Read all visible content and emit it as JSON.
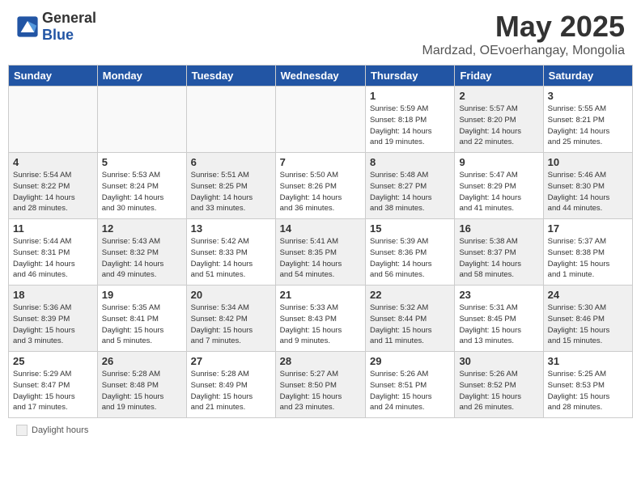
{
  "header": {
    "logo_general": "General",
    "logo_blue": "Blue",
    "month_year": "May 2025",
    "location": "Mardzad, OEvoerhangay, Mongolia"
  },
  "days_of_week": [
    "Sunday",
    "Monday",
    "Tuesday",
    "Wednesday",
    "Thursday",
    "Friday",
    "Saturday"
  ],
  "weeks": [
    [
      {
        "day": "",
        "info": "",
        "empty": true
      },
      {
        "day": "",
        "info": "",
        "empty": true
      },
      {
        "day": "",
        "info": "",
        "empty": true
      },
      {
        "day": "",
        "info": "",
        "empty": true
      },
      {
        "day": "1",
        "info": "Sunrise: 5:59 AM\nSunset: 8:18 PM\nDaylight: 14 hours\nand 19 minutes."
      },
      {
        "day": "2",
        "info": "Sunrise: 5:57 AM\nSunset: 8:20 PM\nDaylight: 14 hours\nand 22 minutes.",
        "shaded": true
      },
      {
        "day": "3",
        "info": "Sunrise: 5:55 AM\nSunset: 8:21 PM\nDaylight: 14 hours\nand 25 minutes."
      }
    ],
    [
      {
        "day": "4",
        "info": "Sunrise: 5:54 AM\nSunset: 8:22 PM\nDaylight: 14 hours\nand 28 minutes.",
        "shaded": true
      },
      {
        "day": "5",
        "info": "Sunrise: 5:53 AM\nSunset: 8:24 PM\nDaylight: 14 hours\nand 30 minutes."
      },
      {
        "day": "6",
        "info": "Sunrise: 5:51 AM\nSunset: 8:25 PM\nDaylight: 14 hours\nand 33 minutes.",
        "shaded": true
      },
      {
        "day": "7",
        "info": "Sunrise: 5:50 AM\nSunset: 8:26 PM\nDaylight: 14 hours\nand 36 minutes."
      },
      {
        "day": "8",
        "info": "Sunrise: 5:48 AM\nSunset: 8:27 PM\nDaylight: 14 hours\nand 38 minutes.",
        "shaded": true
      },
      {
        "day": "9",
        "info": "Sunrise: 5:47 AM\nSunset: 8:29 PM\nDaylight: 14 hours\nand 41 minutes."
      },
      {
        "day": "10",
        "info": "Sunrise: 5:46 AM\nSunset: 8:30 PM\nDaylight: 14 hours\nand 44 minutes.",
        "shaded": true
      }
    ],
    [
      {
        "day": "11",
        "info": "Sunrise: 5:44 AM\nSunset: 8:31 PM\nDaylight: 14 hours\nand 46 minutes."
      },
      {
        "day": "12",
        "info": "Sunrise: 5:43 AM\nSunset: 8:32 PM\nDaylight: 14 hours\nand 49 minutes.",
        "shaded": true
      },
      {
        "day": "13",
        "info": "Sunrise: 5:42 AM\nSunset: 8:33 PM\nDaylight: 14 hours\nand 51 minutes."
      },
      {
        "day": "14",
        "info": "Sunrise: 5:41 AM\nSunset: 8:35 PM\nDaylight: 14 hours\nand 54 minutes.",
        "shaded": true
      },
      {
        "day": "15",
        "info": "Sunrise: 5:39 AM\nSunset: 8:36 PM\nDaylight: 14 hours\nand 56 minutes."
      },
      {
        "day": "16",
        "info": "Sunrise: 5:38 AM\nSunset: 8:37 PM\nDaylight: 14 hours\nand 58 minutes.",
        "shaded": true
      },
      {
        "day": "17",
        "info": "Sunrise: 5:37 AM\nSunset: 8:38 PM\nDaylight: 15 hours\nand 1 minute."
      }
    ],
    [
      {
        "day": "18",
        "info": "Sunrise: 5:36 AM\nSunset: 8:39 PM\nDaylight: 15 hours\nand 3 minutes.",
        "shaded": true
      },
      {
        "day": "19",
        "info": "Sunrise: 5:35 AM\nSunset: 8:41 PM\nDaylight: 15 hours\nand 5 minutes."
      },
      {
        "day": "20",
        "info": "Sunrise: 5:34 AM\nSunset: 8:42 PM\nDaylight: 15 hours\nand 7 minutes.",
        "shaded": true
      },
      {
        "day": "21",
        "info": "Sunrise: 5:33 AM\nSunset: 8:43 PM\nDaylight: 15 hours\nand 9 minutes."
      },
      {
        "day": "22",
        "info": "Sunrise: 5:32 AM\nSunset: 8:44 PM\nDaylight: 15 hours\nand 11 minutes.",
        "shaded": true
      },
      {
        "day": "23",
        "info": "Sunrise: 5:31 AM\nSunset: 8:45 PM\nDaylight: 15 hours\nand 13 minutes."
      },
      {
        "day": "24",
        "info": "Sunrise: 5:30 AM\nSunset: 8:46 PM\nDaylight: 15 hours\nand 15 minutes.",
        "shaded": true
      }
    ],
    [
      {
        "day": "25",
        "info": "Sunrise: 5:29 AM\nSunset: 8:47 PM\nDaylight: 15 hours\nand 17 minutes."
      },
      {
        "day": "26",
        "info": "Sunrise: 5:28 AM\nSunset: 8:48 PM\nDaylight: 15 hours\nand 19 minutes.",
        "shaded": true
      },
      {
        "day": "27",
        "info": "Sunrise: 5:28 AM\nSunset: 8:49 PM\nDaylight: 15 hours\nand 21 minutes."
      },
      {
        "day": "28",
        "info": "Sunrise: 5:27 AM\nSunset: 8:50 PM\nDaylight: 15 hours\nand 23 minutes.",
        "shaded": true
      },
      {
        "day": "29",
        "info": "Sunrise: 5:26 AM\nSunset: 8:51 PM\nDaylight: 15 hours\nand 24 minutes."
      },
      {
        "day": "30",
        "info": "Sunrise: 5:26 AM\nSunset: 8:52 PM\nDaylight: 15 hours\nand 26 minutes.",
        "shaded": true
      },
      {
        "day": "31",
        "info": "Sunrise: 5:25 AM\nSunset: 8:53 PM\nDaylight: 15 hours\nand 28 minutes."
      }
    ]
  ],
  "legend": {
    "label": "Daylight hours"
  }
}
